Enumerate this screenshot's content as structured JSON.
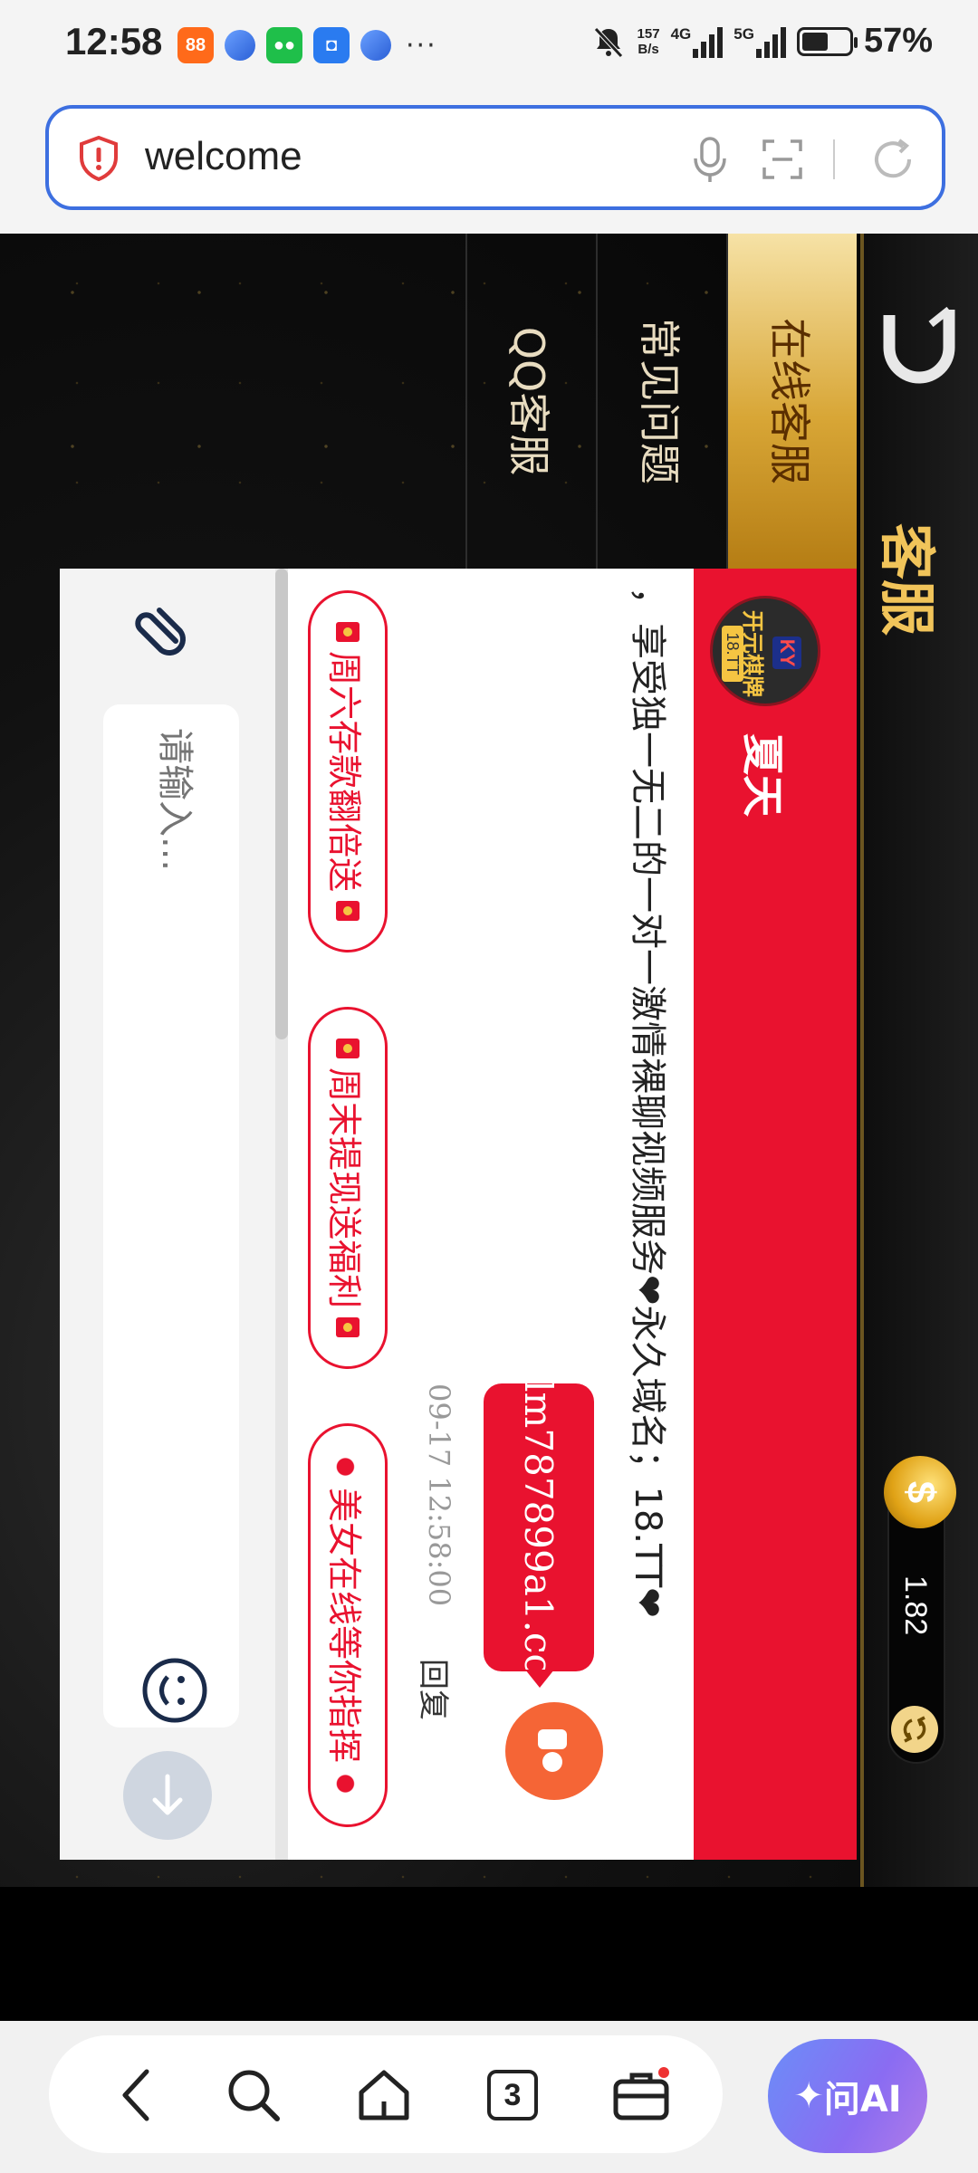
{
  "status_bar": {
    "time": "12:58",
    "app_icons": [
      "taobao-icon",
      "browser-icon",
      "wechat-icon",
      "qq-icon",
      "browser-icon"
    ],
    "net_speed": "157",
    "net_unit": "B/s",
    "signal_1": "4G",
    "signal_2": "5G",
    "battery": "57%",
    "battery_level": 0.57
  },
  "address_bar": {
    "url": "welcome"
  },
  "app": {
    "title": "客服",
    "coin_symbol": "$",
    "balance": "1.82",
    "menu": [
      {
        "label": "在线客服",
        "active": true
      },
      {
        "label": "常见问题",
        "active": false
      },
      {
        "label": "QQ客服",
        "active": false
      }
    ],
    "chat": {
      "avatar": {
        "k": "KY",
        "name": "开元棋牌",
        "num": "18.TT"
      },
      "agent_name": "夏天",
      "notice": "，享受独一无二的一对一激情裸聊视频服务❤永久域名；18.TT❤",
      "message": "lm787899a1.cc",
      "timestamp": "09-17 12:58:00",
      "reply_label": "回复",
      "quick_replies": [
        {
          "text": "周六存款翻倍送",
          "deco": "red-packet"
        },
        {
          "text": "周末提现送福利",
          "deco": "red-packet"
        },
        {
          "text": "美女在线等你指挥",
          "deco": "lips"
        }
      ],
      "input_placeholder": "请输入..."
    }
  },
  "nav": {
    "tab_count": "3",
    "ai_label": "问AI"
  },
  "colors": {
    "accent": "#e9122f",
    "gold": "#f1c45a",
    "browser_blue": "#3d6fe0"
  }
}
